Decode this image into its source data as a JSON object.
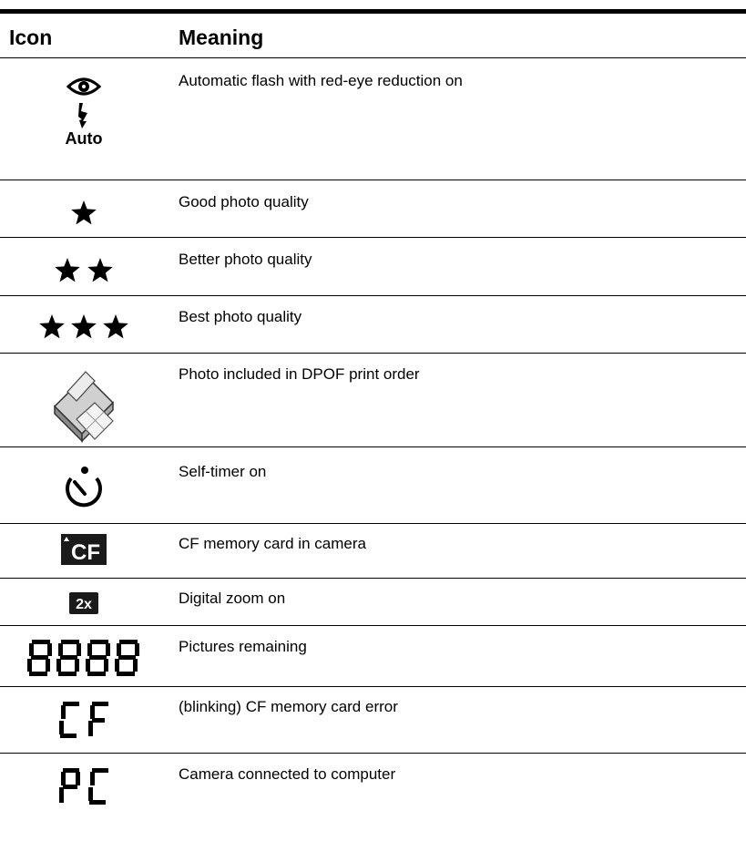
{
  "table": {
    "headers": {
      "icon": "Icon",
      "meaning": "Meaning"
    },
    "rows": [
      {
        "icon": "flash-redeye-auto-icon",
        "icon_text": "Auto",
        "meaning": "Automatic flash with red-eye reduction on"
      },
      {
        "icon": "one-star-icon",
        "meaning": "Good photo quality"
      },
      {
        "icon": "two-star-icon",
        "meaning": "Better photo quality"
      },
      {
        "icon": "three-star-icon",
        "meaning": "Best photo quality"
      },
      {
        "icon": "dpof-printer-icon",
        "meaning": "Photo included in DPOF print order"
      },
      {
        "icon": "self-timer-icon",
        "meaning": "Self-timer on"
      },
      {
        "icon": "cf-card-icon",
        "icon_text": "CF",
        "meaning": "CF memory card in camera"
      },
      {
        "icon": "digital-zoom-icon",
        "icon_text": "2x",
        "meaning": "Digital zoom on"
      },
      {
        "icon": "segment-8888-icon",
        "icon_text": "8888",
        "meaning": "Pictures remaining"
      },
      {
        "icon": "segment-cf-icon",
        "icon_text": "CF",
        "meaning": "(blinking) CF memory card error"
      },
      {
        "icon": "segment-pc-icon",
        "icon_text": "PC",
        "meaning": "Camera connected to computer"
      }
    ]
  }
}
